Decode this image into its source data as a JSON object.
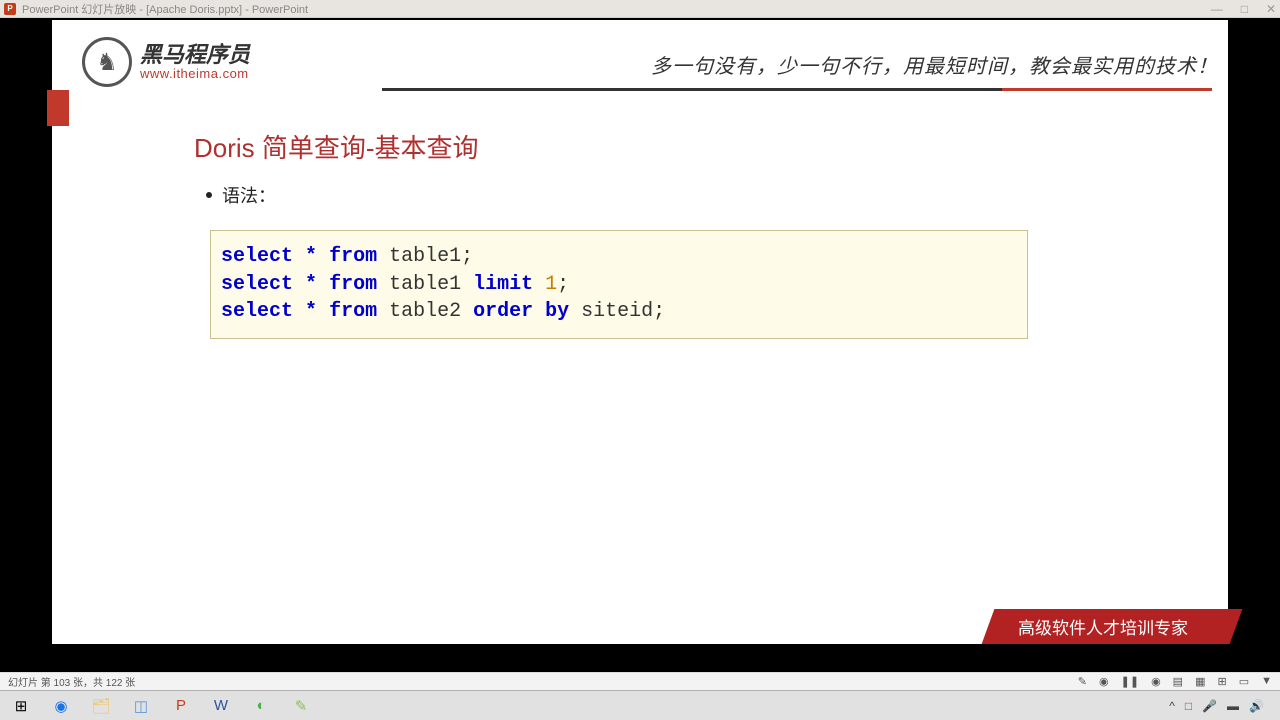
{
  "titlebar": {
    "icon_text": "P",
    "text": "PowerPoint 幻灯片放映 - [Apache Doris.pptx] - PowerPoint"
  },
  "window_controls": {
    "min": "—",
    "max": "□",
    "close": "✕"
  },
  "slide": {
    "logo": {
      "cn": "黑马程序员",
      "url": "www.itheima.com"
    },
    "slogan": "多一句没有，少一句不行，用最短时间，教会最实用的技术！",
    "title": "Doris 简单查询-基本查询",
    "bullet": "语法：",
    "code": {
      "l1_a": "select",
      "l1_b": "*",
      "l1_c": "from",
      "l1_d": " table1;",
      "l2_a": "select",
      "l2_b": "*",
      "l2_c": "from",
      "l2_d": " table1 ",
      "l2_e": "limit",
      "l2_f": "1",
      "l2_g": ";",
      "l3_a": "select",
      "l3_b": "*",
      "l3_c": "from",
      "l3_d": " table2 ",
      "l3_e": "order",
      "l3_f": "by",
      "l3_g": " siteid;"
    },
    "footer_badge": "高级软件人才培训专家"
  },
  "statusbar": {
    "left": "幻灯片 第 103 张，共 122 张"
  },
  "tray": {
    "chevron": "^",
    "square": "□",
    "mic": "🎤",
    "batt": "▬",
    "vol": "🔊"
  }
}
